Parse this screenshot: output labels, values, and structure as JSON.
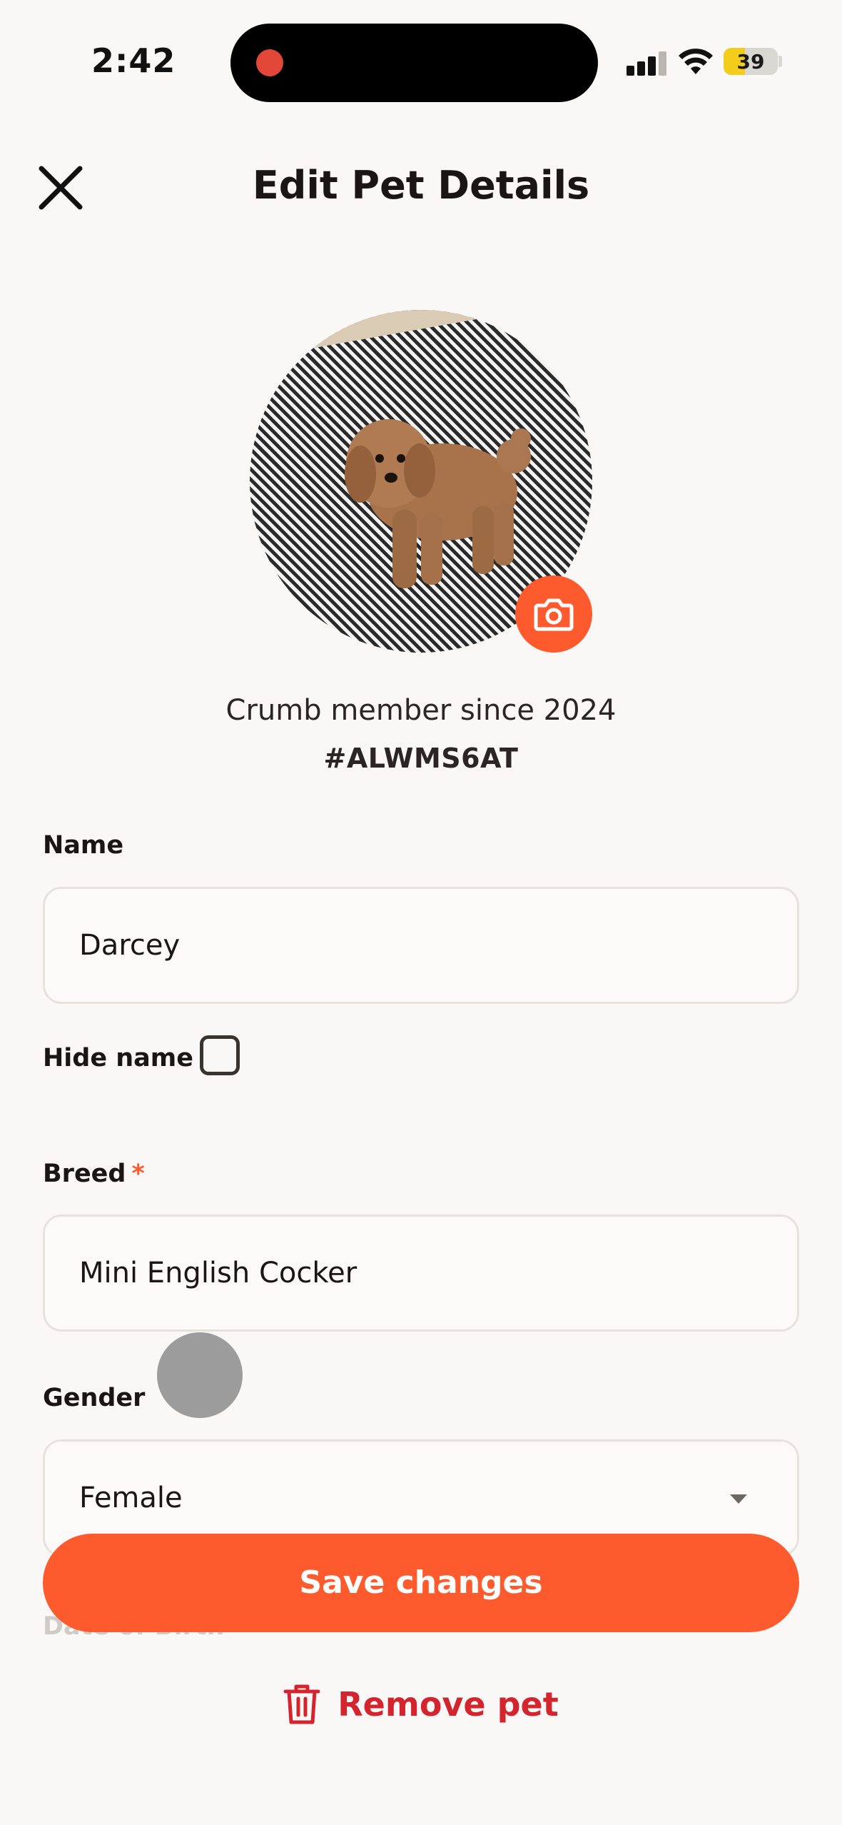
{
  "status_bar": {
    "time": "2:42",
    "battery_percent": "39",
    "battery_level": 0.39,
    "signal_icon": "cellular-signal-icon",
    "wifi_icon": "wifi-icon"
  },
  "header": {
    "title": "Edit Pet Details",
    "close_icon": "close-icon"
  },
  "profile": {
    "photo": "dog-photo",
    "camera_icon": "camera-icon",
    "member_since": "Crumb member since 2024",
    "member_code": "#ALWMS6AT"
  },
  "form": {
    "name": {
      "label": "Name",
      "value": "Darcey"
    },
    "hide_name": {
      "label": "Hide name",
      "checked": false
    },
    "breed": {
      "label": "Breed",
      "required_mark": "*",
      "value": "Mini English Cocker"
    },
    "gender": {
      "label": "Gender",
      "value": "Female",
      "icon": "chevron-down-icon"
    },
    "date_of_birth": {
      "label": "Date of Birth"
    }
  },
  "actions": {
    "save_label": "Save changes",
    "remove_label": "Remove pet",
    "remove_icon": "trash-icon"
  },
  "colors": {
    "accent": "#fd5b2d",
    "danger": "#d4252f",
    "background": "#f9f8f6"
  }
}
